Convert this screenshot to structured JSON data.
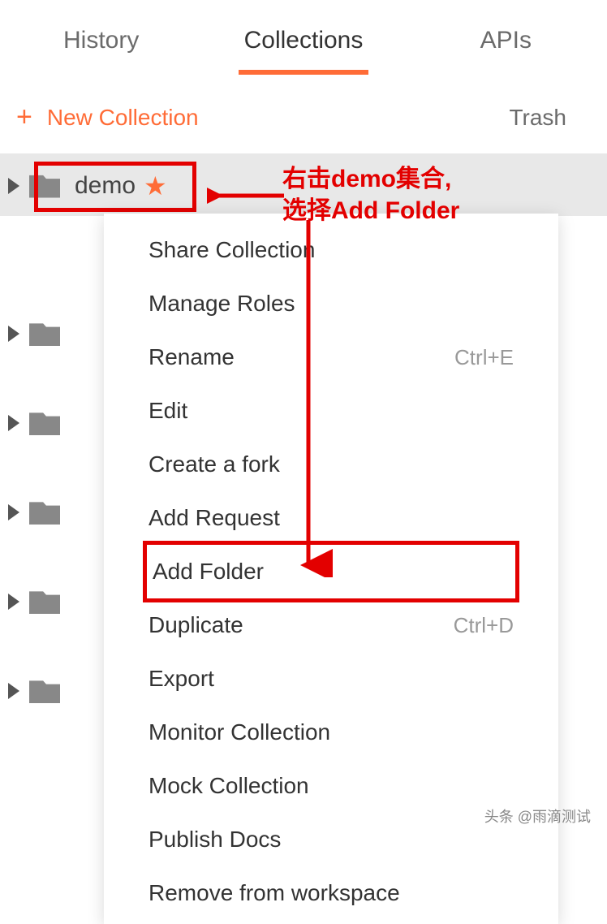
{
  "tabs": {
    "history": "History",
    "collections": "Collections",
    "apis": "APIs"
  },
  "toolbar": {
    "new_collection": "New Collection",
    "trash": "Trash"
  },
  "collection": {
    "name": "demo"
  },
  "menu": {
    "share": "Share Collection",
    "manage_roles": "Manage Roles",
    "rename": "Rename",
    "rename_shortcut": "Ctrl+E",
    "edit": "Edit",
    "create_fork": "Create a fork",
    "add_request": "Add Request",
    "add_folder": "Add Folder",
    "duplicate": "Duplicate",
    "duplicate_shortcut": "Ctrl+D",
    "export": "Export",
    "monitor": "Monitor Collection",
    "mock": "Mock Collection",
    "publish_docs": "Publish Docs",
    "remove": "Remove from workspace"
  },
  "annotation": {
    "line1": "右击demo集合,",
    "line2": "选择Add Folder"
  },
  "watermark": "头条 @雨滴测试"
}
